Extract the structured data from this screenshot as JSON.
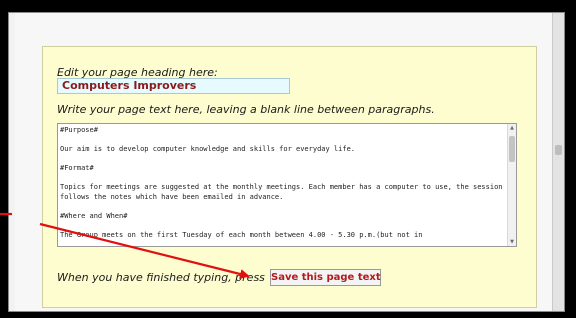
{
  "editor": {
    "heading_label": "Edit your page heading here:",
    "heading_value": "Computers Improvers",
    "text_label": "Write your page text here, leaving a blank line between paragraphs.",
    "paragraphs": [
      "#Purpose#",
      "Our aim is to develop computer knowledge and skills for everyday life.",
      "#Format#",
      "Topics for meetings are suggested at the monthly meetings. Each member has a computer to use, the session follows the notes which have been emailed in advance.",
      "#Where and When#",
      "The Group meets on the first Tuesday of each month between 4.00 - 5.30 p.m.(but not in"
    ],
    "footer_label": "When you have finished typing, press",
    "save_label": "Save this page text"
  },
  "colors": {
    "panel_background": "#fefdd0",
    "heading_text": "#8b1a1a",
    "save_text": "#b31b1b",
    "annotation_arrow": "#e01010"
  },
  "icons": {
    "scroll_up": "arrow-up-icon",
    "scroll_down": "arrow-down-icon"
  }
}
